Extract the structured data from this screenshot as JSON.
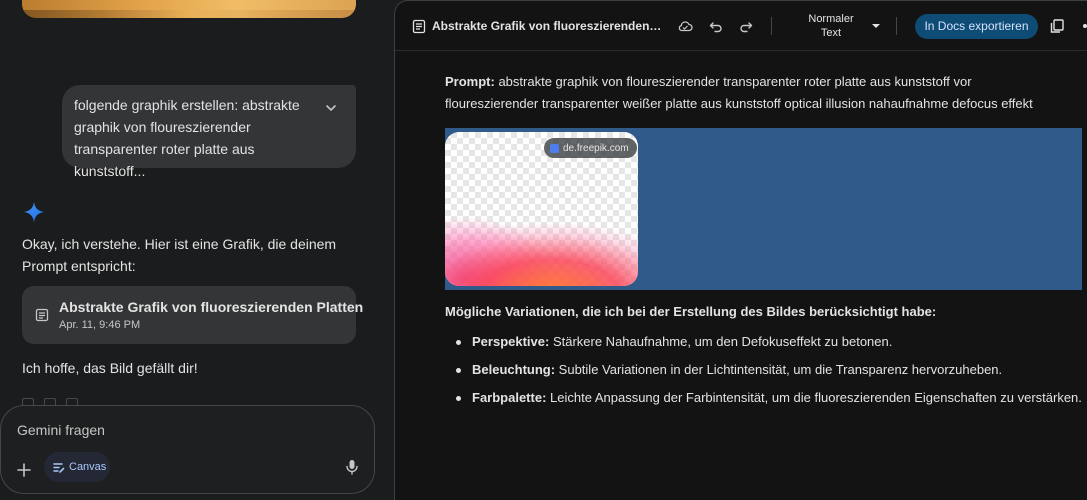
{
  "chat": {
    "user_message": "folgende graphik erstellen: abstrakte graphik von floureszierender transparenter roter platte aus kunststoff...",
    "reply_text": "Okay, ich verstehe. Hier ist eine Grafik, die deinem Prompt entspricht:",
    "doc_chip": {
      "title": "Abstrakte Grafik von fluoreszierenden Platten",
      "date": "Apr. 11, 9:46 PM"
    },
    "closing_text": "Ich hoffe, das Bild gefällt dir!",
    "input": {
      "placeholder": "Gemini fragen",
      "canvas_label": "Canvas"
    }
  },
  "doc": {
    "title": "Abstrakte Grafik von fluoreszierenden…",
    "style_select": "Normaler Text",
    "export_button": "In Docs exportieren",
    "prompt_label": "Prompt:",
    "prompt_text": " abstrakte graphik von floureszierender transparenter roter platte aus kunststoff vor floureszierender transparenter weißer platte aus kunststoff optical illusion nahaufnahme defocus effekt",
    "image_source": "de.freepik.com",
    "variations_heading": "Mögliche Variationen, die ich bei der Erstellung des Bildes berücksichtigt habe:",
    "variations": [
      {
        "label": "Perspektive:",
        "text": " Stärkere Nahaufnahme, um den Defokuseffekt zu betonen."
      },
      {
        "label": "Beleuchtung:",
        "text": " Subtile Variationen in der Lichtintensität, um die Transparenz hervorzuheben."
      },
      {
        "label": "Farbpalette:",
        "text": " Leichte Anpassung der Farbintensität, um die fluoreszierenden Eigenschaften zu verstärken."
      }
    ]
  },
  "colors": {
    "accent_blue": "#a8c7fa",
    "export_button_bg": "#0f4c75",
    "selection_highlight": "#2f5a8a"
  },
  "icons": {
    "gemini": "sparkle-icon",
    "document": "document-icon",
    "cloud": "cloud-icon",
    "undo": "undo-icon",
    "redo": "redo-icon",
    "copy": "copy-icon",
    "mic": "microphone-icon",
    "add": "plus-icon"
  }
}
